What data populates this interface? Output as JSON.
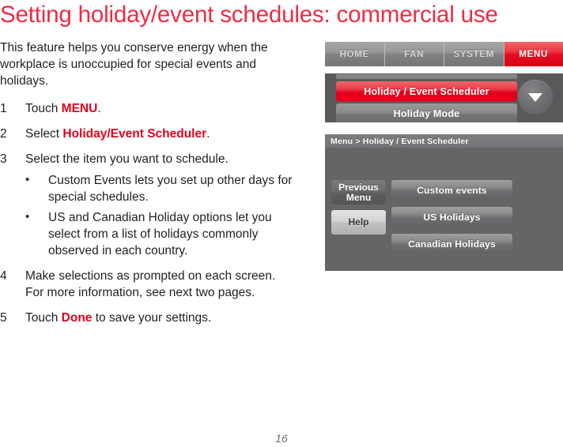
{
  "page": {
    "title": "Setting holiday/event schedules: commercial use",
    "title_color": "#ee2b45",
    "accent_color": "#e2001a",
    "folio": "16"
  },
  "body": {
    "intro": "This feature helps you conserve energy when the workplace is unoccupied for special events and holidays.",
    "steps": [
      {
        "num": "1",
        "pre": "Touch ",
        "keyword": "MENU",
        "post": "."
      },
      {
        "num": "2",
        "pre": "Select ",
        "keyword": "Holiday/Event Scheduler",
        "post": "."
      },
      {
        "num": "3",
        "pre": "Select the item you want to schedule.",
        "keyword": "",
        "post": "",
        "bullets": [
          "Custom Events lets you set up other days for special schedules.",
          "US and Canadian Holiday options let you select from a list of holidays commonly observed in each country."
        ]
      },
      {
        "num": "4",
        "pre": "Make selections as prompted on each screen. For more information, see next two pages.",
        "keyword": "",
        "post": ""
      },
      {
        "num": "5",
        "pre": "Touch ",
        "keyword": "Done",
        "post": " to save your settings."
      }
    ],
    "bullet_glyph": "•"
  },
  "device": {
    "tabbar": {
      "tabs": [
        {
          "label": "HOME",
          "active": false
        },
        {
          "label": "FAN",
          "active": false
        },
        {
          "label": "SYSTEM",
          "active": false
        },
        {
          "label": "MENU",
          "active": true
        }
      ],
      "active_color": "#e30e21"
    },
    "menu_screen": {
      "items": [
        {
          "label": "Holiday / Event Scheduler",
          "selected": true
        },
        {
          "label": "Holiday Mode",
          "selected": false
        }
      ],
      "scroll_down_icon": "chevron-down-icon"
    },
    "detail_screen": {
      "breadcrumb": "Menu > Holiday / Event Scheduler",
      "side_buttons": [
        {
          "line1": "Previous",
          "line2": "Menu",
          "style": "dark"
        },
        {
          "line1": "Help",
          "line2": "",
          "style": "light"
        }
      ],
      "main_buttons": [
        {
          "label": "Custom events"
        },
        {
          "label": "US Holidays"
        },
        {
          "label": "Canadian Holidays"
        }
      ]
    }
  }
}
